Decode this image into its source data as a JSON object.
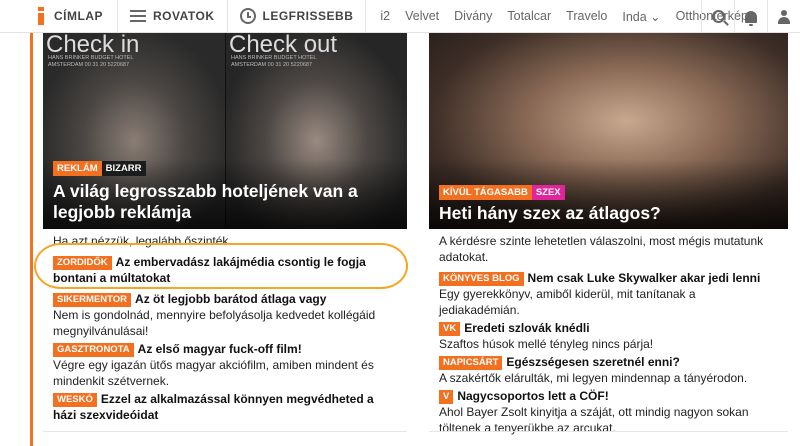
{
  "nav": {
    "home_label": "CÍMLAP",
    "sections_label": "ROVATOK",
    "latest_label": "LEGFRISSEBB",
    "sites": [
      "i2",
      "Velvet",
      "Divány",
      "Totalcar",
      "Travelo",
      "Inda ⌄",
      "Otthontérkép"
    ],
    "icons": [
      "search-icon",
      "bell-icon",
      "user-icon"
    ]
  },
  "left": {
    "hero": {
      "panel_a_text": "Check in",
      "panel_b_text": "Check out",
      "panel_sub": "HANS BRINKER BUDGET HOTEL AMSTERDAM 00 31 20 5220687",
      "tags": [
        "REKLÁM",
        "BIZARR"
      ],
      "title": "A világ legrosszabb hoteljének van a legjobb reklámja"
    },
    "lead": "Ha azt nézzük, legalább őszinték.",
    "items": [
      {
        "tag": "ZORDIDŐK",
        "headline": "Az embervadász lakájmédia csontig le fogja bontani a múltatokat",
        "desc": ""
      },
      {
        "tag": "SIKERMENTOR",
        "headline": "Az öt legjobb barátod átlaga vagy",
        "desc": "Nem is gondolnád, mennyire befolyásolja kedvedet kollégáid megnyilvánulásai!"
      },
      {
        "tag": "GASZTRONOTA",
        "headline": "Az első magyar fuck-off film!",
        "desc": "Végre egy igazán ütős magyar akciófilm, amiben mindent és mindenkit szétvernek."
      },
      {
        "tag": "WESKÓ",
        "headline": "Ezzel az alkalmazással könnyen megvédheted a házi szexvideóidat",
        "desc": ""
      }
    ]
  },
  "right": {
    "hero": {
      "tags": [
        "KÍVÜL TÁGASABB",
        "SZEX"
      ],
      "title": "Heti hány szex az átlagos?"
    },
    "lead": "A kérdésre szinte lehetetlen válaszolni, most mégis mutatunk adatokat.",
    "items": [
      {
        "tag": "KÖNYVES BLOG",
        "headline": "Nem csak Luke Skywalker akar jedi lenni",
        "desc": "Egy gyerekkönyv, amiből kiderül, mit tanítanak a jediakadémián."
      },
      {
        "tag": "VK",
        "headline": "Eredeti szlovák knédli",
        "desc": "Szaftos húsok mellé tényleg nincs párja!"
      },
      {
        "tag": "NAPICSÁRT",
        "headline": "Egészségesen szeretnél enni?",
        "desc": "A szakértők elárulták, mi legyen mindennap a tányérodon."
      },
      {
        "tag": "V",
        "headline": "Nagycsoportos lett a CÖF!",
        "desc": "Ahol Bayer Zsolt kinyitja a száját, ott mindig nagyon sokan töltenek a tenyerükbe az arcukat."
      }
    ]
  },
  "colors": {
    "accent": "#f37021",
    "highlight": "#f5a623",
    "pink": "#e0249a"
  }
}
